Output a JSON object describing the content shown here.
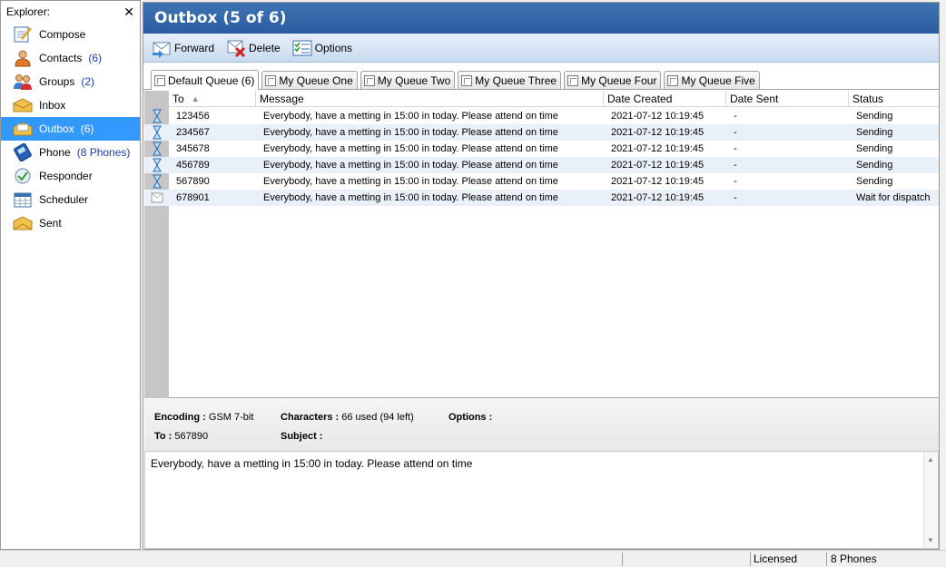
{
  "explorer": {
    "title": "Explorer:",
    "close_label": "✕",
    "items": [
      {
        "label": "Compose",
        "count": "",
        "icon": "compose-icon"
      },
      {
        "label": "Contacts",
        "count": "(6)",
        "icon": "contacts-icon"
      },
      {
        "label": "Groups",
        "count": "(2)",
        "icon": "groups-icon"
      },
      {
        "label": "Inbox",
        "count": "",
        "icon": "inbox-icon"
      },
      {
        "label": "Outbox",
        "count": "(6)",
        "icon": "outbox-icon"
      },
      {
        "label": "Phone",
        "count": "(8 Phones)",
        "icon": "phone-icon"
      },
      {
        "label": "Responder",
        "count": "",
        "icon": "responder-icon"
      },
      {
        "label": "Scheduler",
        "count": "",
        "icon": "scheduler-icon"
      },
      {
        "label": "Sent",
        "count": "",
        "icon": "sent-icon"
      }
    ],
    "selected_index": 4
  },
  "header": {
    "title": "Outbox (5 of 6)"
  },
  "toolbar": {
    "forward_label": "Forward",
    "delete_label": "Delete",
    "options_label": "Options"
  },
  "tabs": [
    {
      "label": "Default Queue (6)",
      "active": true
    },
    {
      "label": "My Queue One",
      "active": false
    },
    {
      "label": "My Queue Two",
      "active": false
    },
    {
      "label": "My Queue Three",
      "active": false
    },
    {
      "label": "My Queue Four",
      "active": false
    },
    {
      "label": "My Queue Five",
      "active": false
    }
  ],
  "grid": {
    "columns": [
      "To",
      "Message",
      "Date Created",
      "Date Sent",
      "Status"
    ],
    "rows": [
      {
        "icon": "hourglass-icon",
        "to": "123456",
        "message": "Everybody, have a metting in 15:00 in today. Please attend on time",
        "date_created": "2021-07-12 10:19:45",
        "date_sent": "-",
        "status": "Sending"
      },
      {
        "icon": "hourglass-icon",
        "to": "234567",
        "message": "Everybody, have a metting in 15:00 in today. Please attend on time",
        "date_created": "2021-07-12 10:19:45",
        "date_sent": "-",
        "status": "Sending"
      },
      {
        "icon": "hourglass-icon",
        "to": "345678",
        "message": "Everybody, have a metting in 15:00 in today. Please attend on time",
        "date_created": "2021-07-12 10:19:45",
        "date_sent": "-",
        "status": "Sending"
      },
      {
        "icon": "hourglass-icon",
        "to": "456789",
        "message": "Everybody, have a metting in 15:00 in today. Please attend on time",
        "date_created": "2021-07-12 10:19:45",
        "date_sent": "-",
        "status": "Sending"
      },
      {
        "icon": "hourglass-icon",
        "to": "567890",
        "message": "Everybody, have a metting in 15:00 in today. Please attend on time",
        "date_created": "2021-07-12 10:19:45",
        "date_sent": "-",
        "status": "Sending"
      },
      {
        "icon": "envelope-icon",
        "to": "678901",
        "message": "Everybody, have a metting in 15:00 in today. Please attend on time",
        "date_created": "2021-07-12 10:19:45",
        "date_sent": "-",
        "status": "Wait for dispatch"
      }
    ]
  },
  "details": {
    "encoding_label": "Encoding :",
    "encoding_value": "GSM 7-bit",
    "characters_label": "Characters :",
    "characters_value": "66 used (94 left)",
    "options_label": "Options :",
    "to_label": "To :",
    "to_value": "567890",
    "subject_label": "Subject :",
    "message": "Everybody, have a metting in 15:00 in today. Please attend on time"
  },
  "statusbar": {
    "license": "Licensed",
    "phones": "8 Phones"
  },
  "colors": {
    "title_bar": "#2f64a6",
    "selected_item": "#3399ff",
    "count_text": "#1a3ea8",
    "alt_row": "#eaf0f8"
  }
}
